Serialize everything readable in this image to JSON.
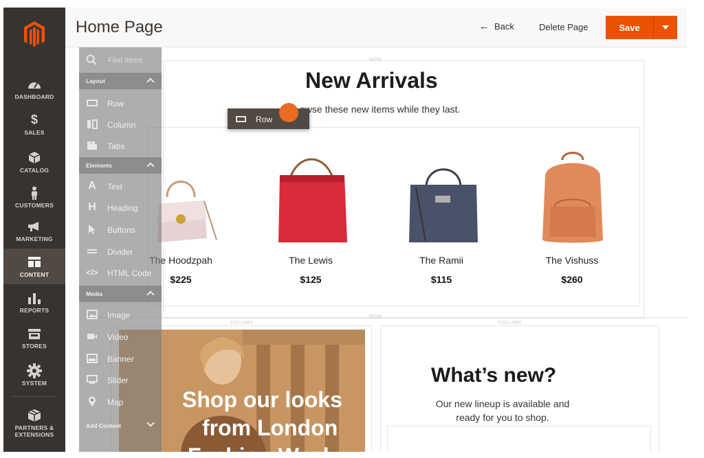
{
  "admin_nav": {
    "items": [
      {
        "label": "DASHBOARD",
        "icon": "dashboard-icon"
      },
      {
        "label": "SALES",
        "icon": "dollar-icon"
      },
      {
        "label": "CATALOG",
        "icon": "cube-icon"
      },
      {
        "label": "CUSTOMERS",
        "icon": "person-icon"
      },
      {
        "label": "MARKETING",
        "icon": "megaphone-icon"
      },
      {
        "label": "CONTENT",
        "icon": "layout-icon"
      },
      {
        "label": "REPORTS",
        "icon": "bar-chart-icon"
      },
      {
        "label": "STORES",
        "icon": "store-icon"
      },
      {
        "label": "SYSTEM",
        "icon": "gear-icon"
      },
      {
        "label": "PARTNERS & EXTENSIONS",
        "icon": "box-icon"
      }
    ],
    "active": "CONTENT"
  },
  "header": {
    "title": "Home Page",
    "back_label": "Back",
    "delete_label": "Delete Page",
    "save_label": "Save"
  },
  "builder": {
    "search_placeholder": "Find items",
    "sections": {
      "layout": {
        "title": "Layout",
        "items": [
          {
            "label": "Row",
            "icon": "row-icon"
          },
          {
            "label": "Column",
            "icon": "column-icon"
          },
          {
            "label": "Tabs",
            "icon": "tabs-icon"
          }
        ]
      },
      "elements": {
        "title": "Elements",
        "items": [
          {
            "label": "Text",
            "icon": "text-icon"
          },
          {
            "label": "Heading",
            "icon": "heading-icon"
          },
          {
            "label": "Buttons",
            "icon": "cursor-icon"
          },
          {
            "label": "Divider",
            "icon": "divider-icon"
          },
          {
            "label": "HTML Code",
            "icon": "code-icon"
          }
        ]
      },
      "media": {
        "title": "Media",
        "items": [
          {
            "label": "Image",
            "icon": "image-icon"
          },
          {
            "label": "Video",
            "icon": "video-icon"
          },
          {
            "label": "Banner",
            "icon": "banner-icon"
          },
          {
            "label": "Slider",
            "icon": "slider-icon"
          },
          {
            "label": "Map",
            "icon": "map-pin-icon"
          }
        ]
      },
      "add_content": {
        "title": "Add Content"
      }
    }
  },
  "drag_ghost": {
    "label": "Row"
  },
  "stage": {
    "row_label": "ROW",
    "column_label": "COLUMN",
    "heading": "New Arrivals",
    "subtitle": "Browse these new items while they last.",
    "subtitle_visible": "owse these new items while they last.",
    "products": [
      {
        "name": "The Hoodzpah",
        "price": "$225",
        "color": "#e7d2d3"
      },
      {
        "name": "The Lewis",
        "price": "$125",
        "color": "#d92a3a"
      },
      {
        "name": "The Ramii",
        "price": "$115",
        "color": "#4a5269"
      },
      {
        "name": "The Vishuss",
        "price": "$260",
        "color": "#e0895a"
      }
    ],
    "promo_lines": [
      "Shop our looks",
      "from London",
      "Fashion Week"
    ],
    "whats_new_title": "What’s new?",
    "whats_new_lines": [
      "Our new lineup is available and",
      "ready for you to shop."
    ]
  },
  "colors": {
    "accent": "#eb5202",
    "sidebar": "#373330",
    "sidebar_active": "#514943"
  }
}
